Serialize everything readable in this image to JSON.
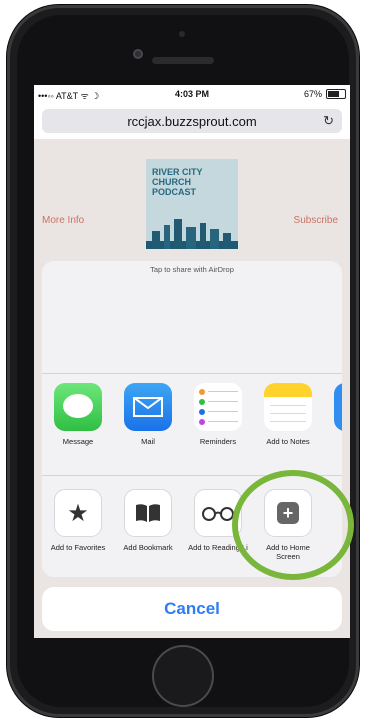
{
  "status_bar": {
    "carrier": "•••◦◦ AT&T ᯤ ☽",
    "time": "4:03 PM",
    "battery": "67%",
    "battery_level": 0.67
  },
  "browser": {
    "url": "rccjax.buzzsprout.com",
    "reload_icon": "↻"
  },
  "page": {
    "podcast_art_text": "RIVER CITY CHURCH PODCAST",
    "left_link": "More Info",
    "right_link": "Subscribe"
  },
  "share_sheet": {
    "airdrop_hint": "Tap to share with AirDrop",
    "apps": [
      {
        "label": "Message",
        "icon": "message-icon"
      },
      {
        "label": "Mail",
        "icon": "mail-icon"
      },
      {
        "label": "Reminders",
        "icon": "reminders-icon"
      },
      {
        "label": "Add to Notes",
        "icon": "notes-icon"
      }
    ],
    "actions": [
      {
        "label": "Add to Favorites",
        "icon": "star-icon",
        "glyph": "★"
      },
      {
        "label": "Add Bookmark",
        "icon": "book-icon",
        "glyph": "📖"
      },
      {
        "label": "Add to Reading Li",
        "icon": "reading-list-icon",
        "glyph": "∞"
      },
      {
        "label": "Add to Home Screen",
        "icon": "add-home-screen-icon",
        "glyph": "+"
      }
    ],
    "cancel_label": "Cancel"
  },
  "colors": {
    "highlight_ring": "#7ab63b",
    "cancel_text": "#2f7df6",
    "accent_link": "#d5796b"
  }
}
